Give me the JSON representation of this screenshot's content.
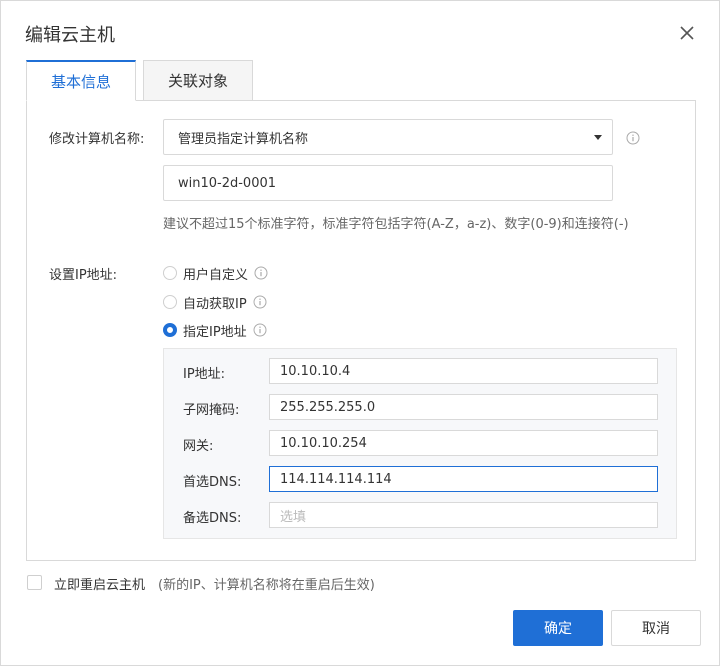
{
  "dialog": {
    "title": "编辑云主机"
  },
  "tabs": [
    {
      "label": "基本信息"
    },
    {
      "label": "关联对象"
    }
  ],
  "basic": {
    "rename_label": "修改计算机名称:",
    "rename_select": "管理员指定计算机名称",
    "computer_name": "win10-2d-0001",
    "hint": "建议不超过15个标准字符，标准字符包括字符(A-Z，a-z)、数字(0-9)和连接符(-)"
  },
  "ip": {
    "label": "设置IP地址:",
    "options": [
      {
        "label": "用户自定义"
      },
      {
        "label": "自动获取IP"
      },
      {
        "label": "指定IP地址"
      }
    ],
    "selected": "指定IP地址",
    "fields": {
      "ip_label": "IP地址:",
      "ip_value": "10.10.10.4",
      "mask_label": "子网掩码:",
      "mask_value": "255.255.255.0",
      "gateway_label": "网关:",
      "gateway_value": "10.10.10.254",
      "dns1_label": "首选DNS:",
      "dns1_value": "114.114.114.114",
      "dns2_label": "备选DNS:",
      "dns2_placeholder": "选填"
    }
  },
  "footer": {
    "restart_label": "立即重启云主机",
    "restart_note": "(新的IP、计算机名称将在重启后生效)",
    "ok_label": "确定",
    "cancel_label": "取消"
  },
  "colors": {
    "accent": "#1f6fd6",
    "border": "#d9d9d9"
  },
  "icons": {
    "close": "close-icon",
    "info": "info-icon",
    "caret": "caret-down-icon"
  }
}
